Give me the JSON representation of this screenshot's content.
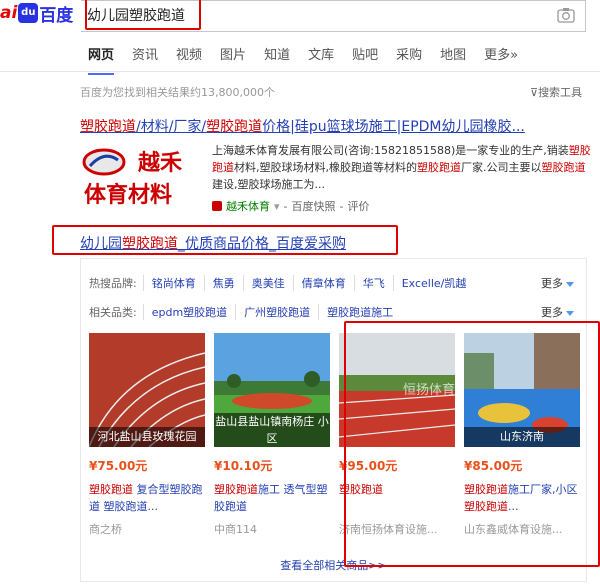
{
  "header": {
    "logo_ai": "ai",
    "logo_du": "du",
    "logo_cn": "百度",
    "search_value": "幼儿园塑胶跑道",
    "camera_icon": "camera-icon"
  },
  "tabs": [
    {
      "label": "网页",
      "active": true
    },
    {
      "label": "资讯"
    },
    {
      "label": "视频"
    },
    {
      "label": "图片"
    },
    {
      "label": "知道"
    },
    {
      "label": "文库"
    },
    {
      "label": "贴吧"
    },
    {
      "label": "采购"
    },
    {
      "label": "地图"
    },
    {
      "label": "更多»"
    }
  ],
  "result_count": "百度为您找到相关结果约13,800,000个",
  "search_tools": "搜索工具",
  "result1": {
    "title_parts": [
      {
        "t": "塑胶跑道",
        "em": true
      },
      {
        "t": "/材料/厂家/"
      },
      {
        "t": "塑胶跑道",
        "em": true
      },
      {
        "t": "价格|硅pu篮球场施工|EPDM幼儿园橡胶..."
      }
    ],
    "logo_text_top": "越禾",
    "logo_text_bottom": "体育材料",
    "desc_parts": [
      {
        "t": "上海越禾体育发展有限公司(咨询:15821851588)是一家专业的生产,销装"
      },
      {
        "t": "塑胶跑道",
        "em": true
      },
      {
        "t": "材料,塑胶球场材料,橡胶跑道等材料的"
      },
      {
        "t": "塑胶跑道",
        "em": true
      },
      {
        "t": "厂家.公司主要以"
      },
      {
        "t": "塑胶跑道",
        "em": true
      },
      {
        "t": "建设,塑胶球场施工为..."
      }
    ],
    "source_name": "越禾体育",
    "snapshot": "百度快照",
    "review": "评价"
  },
  "result2": {
    "title_parts": [
      {
        "t": "幼儿园",
        "em": false
      },
      {
        "t": "塑胶跑道",
        "em": true
      },
      {
        "t": "_优质商品价格_百度爱采购"
      }
    ],
    "hot_brand_label": "热搜品牌:",
    "hot_brands": [
      "铭尚体育",
      "焦勇",
      "奥美佳",
      "倩章体育",
      "华飞",
      "Excelle/凯越"
    ],
    "related_label": "相关品类:",
    "related": [
      "epdm塑胶跑道",
      "广州塑胶跑道",
      "塑胶跑道施工"
    ],
    "more_label": "更多",
    "products": [
      {
        "caption": "河北盐山县玫瑰花园",
        "price": "¥75.00元",
        "desc_parts": [
          {
            "t": "塑胶跑道",
            "em": true
          },
          {
            "t": " 复合型塑胶跑道 塑胶跑道..."
          }
        ],
        "shop": "商之桥"
      },
      {
        "caption": "盐山县盐山镇南杨庄 小区",
        "price": "¥10.10元",
        "desc_parts": [
          {
            "t": "塑胶跑道",
            "em": true
          },
          {
            "t": "施工 透气型塑胶跑道"
          }
        ],
        "shop": "中商114"
      },
      {
        "caption": "恒扬体育",
        "price": "¥95.00元",
        "desc_parts": [
          {
            "t": "塑胶跑道",
            "em": true
          }
        ],
        "shop": "济南恒扬体育设施..."
      },
      {
        "caption": "山东济南",
        "price": "¥85.00元",
        "desc_parts": [
          {
            "t": "塑胶跑道",
            "em": true
          },
          {
            "t": "施工厂家,小区"
          },
          {
            "t": "塑胶跑道",
            "em": true
          },
          {
            "t": "..."
          }
        ],
        "shop": "山东鑫威体育设施..."
      }
    ],
    "view_all": "查看全部相关商品>>"
  }
}
